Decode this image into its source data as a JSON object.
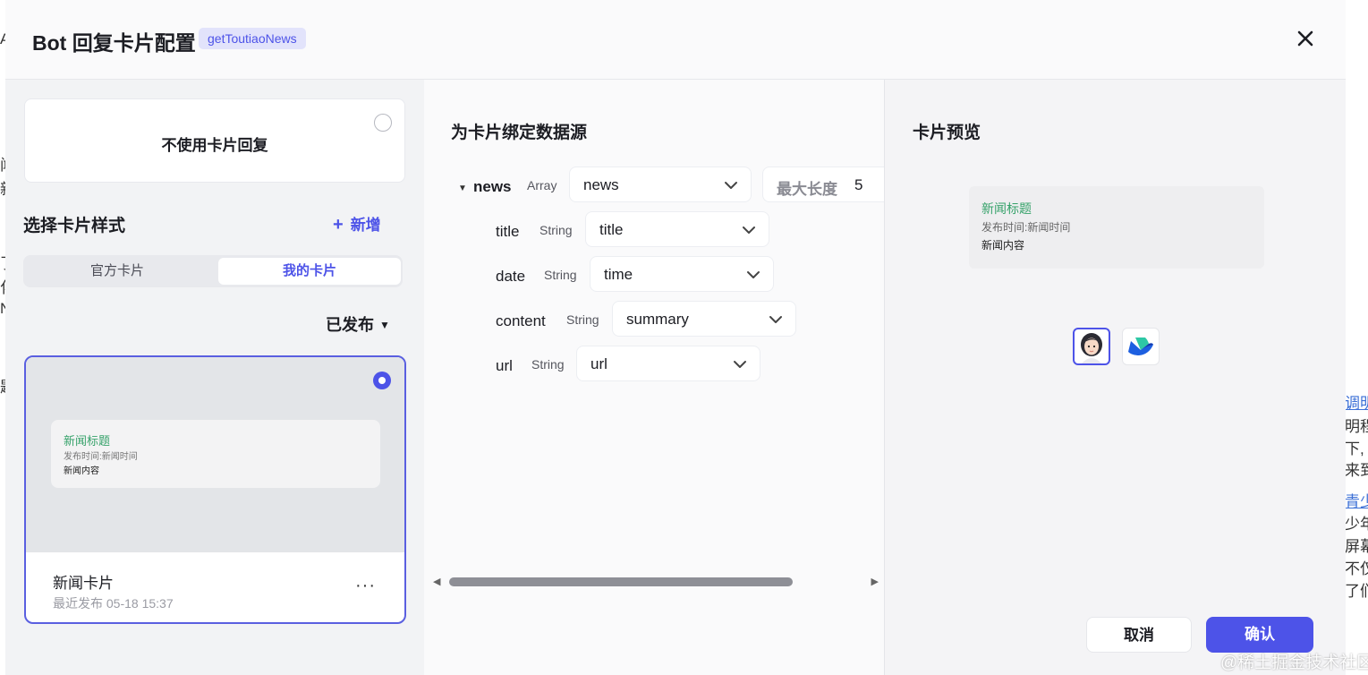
{
  "background": {
    "left_fragments": [
      "A",
      "闻",
      "新",
      "了",
      "化",
      "N",
      "题"
    ],
    "right_fragments": [
      {
        "text": "调明",
        "link": true
      },
      {
        "text": "明程",
        "link": false
      },
      {
        "text": "下,",
        "link": false
      },
      {
        "text": "来到",
        "link": false
      },
      {
        "text": "青少",
        "link": true
      },
      {
        "text": "少年",
        "link": false
      },
      {
        "text": "屏幕",
        "link": false
      },
      {
        "text": "不仅",
        "link": false
      },
      {
        "text": "了们",
        "link": false
      }
    ]
  },
  "header": {
    "title": "Bot 回复卡片配置",
    "tag": "getToutiaoNews",
    "close_icon": "close-icon"
  },
  "left": {
    "no_card_label": "不使用卡片回复",
    "section_title": "选择卡片样式",
    "add_label": "新增",
    "add_icon": "+",
    "tabs": [
      "官方卡片",
      "我的卡片"
    ],
    "active_tab": 1,
    "filter_label": "已发布",
    "card": {
      "preview_title": "新闻标题",
      "preview_sub": "发布时间:新闻时间",
      "preview_content": "新闻内容",
      "name": "新闻卡片",
      "time": "最近发布 05-18 15:37",
      "more": "···"
    }
  },
  "middle": {
    "title": "为卡片绑定数据源",
    "root": {
      "name": "news",
      "type": "Array",
      "value": "news"
    },
    "max_length_label": "最大长度",
    "max_length_value": "5",
    "fields": [
      {
        "name": "title",
        "type": "String",
        "value": "title"
      },
      {
        "name": "date",
        "type": "String",
        "value": "time"
      },
      {
        "name": "content",
        "type": "String",
        "value": "summary"
      },
      {
        "name": "url",
        "type": "String",
        "value": "url"
      }
    ]
  },
  "right": {
    "title": "卡片预览",
    "preview_title": "新闻标题",
    "preview_sub": "发布时间:新闻时间",
    "preview_content": "新闻内容",
    "platforms": [
      "avatar-icon",
      "feishu-logo-icon"
    ]
  },
  "footer": {
    "cancel_label": "取消",
    "ok_label": "确认"
  },
  "watermark": "@稀土掘金技术社区",
  "colors": {
    "accent": "#4d53e8",
    "green_title": "#36a26a"
  }
}
